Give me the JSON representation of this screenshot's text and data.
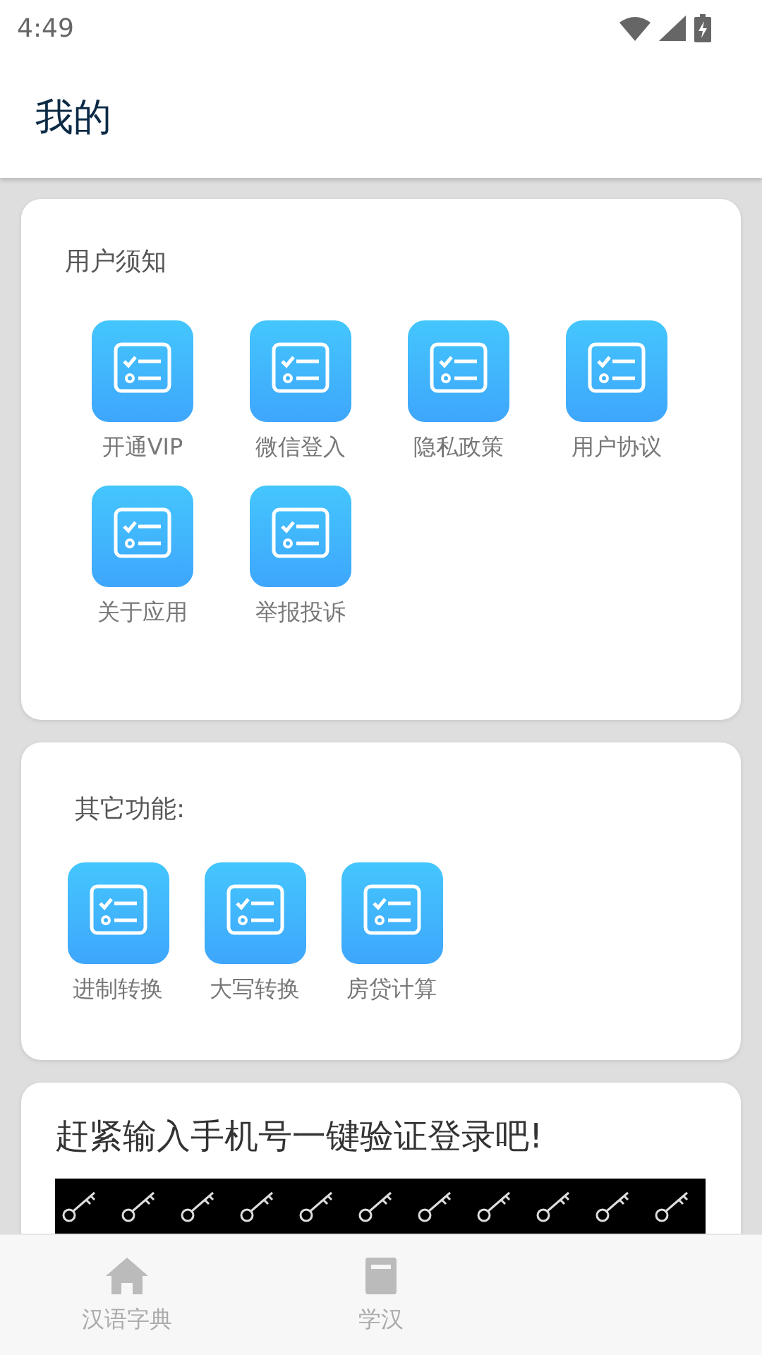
{
  "status_bar": {
    "time": "4:49"
  },
  "app_bar": {
    "title": "我的"
  },
  "notice_section": {
    "title": "用户须知",
    "items": [
      {
        "label": "开通VIP"
      },
      {
        "label": "微信登入"
      },
      {
        "label": "隐私政策"
      },
      {
        "label": "用户协议"
      },
      {
        "label": "关于应用"
      },
      {
        "label": "举报投诉"
      }
    ]
  },
  "other_section": {
    "title": "其它功能:",
    "items": [
      {
        "label": "进制转换"
      },
      {
        "label": "大写转换"
      },
      {
        "label": "房贷计算"
      }
    ]
  },
  "login_card": {
    "title": "赶紧输入手机号一键验证登录吧!"
  },
  "bottom_nav": {
    "tabs": [
      {
        "label": "汉语字典",
        "kind": "home"
      },
      {
        "label": "学汉",
        "kind": "study"
      }
    ]
  }
}
